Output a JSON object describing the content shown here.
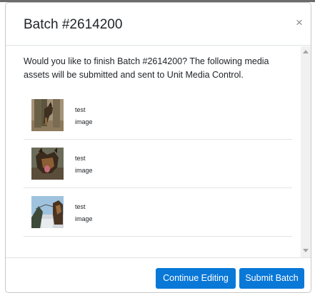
{
  "modal": {
    "title": "Batch #2614200",
    "close_label": "×"
  },
  "body": {
    "intro": "Would you like to finish Batch #2614200? The following media assets will be submitted and sent to Unit Media Control.",
    "items": [
      {
        "line1": "test",
        "line2": "image",
        "thumbnail": "soldier-with-dog-image"
      },
      {
        "line1": "test",
        "line2": "image",
        "thumbnail": "german-shepherd-image"
      },
      {
        "line1": "test",
        "line2": "image",
        "thumbnail": "dog-outdoor-image"
      }
    ]
  },
  "footer": {
    "continue_label": "Continue Editing",
    "submit_label": "Submit Batch"
  },
  "colors": {
    "primary_button": "#0a78d7",
    "text": "#212529",
    "divider": "#dee2e6"
  }
}
